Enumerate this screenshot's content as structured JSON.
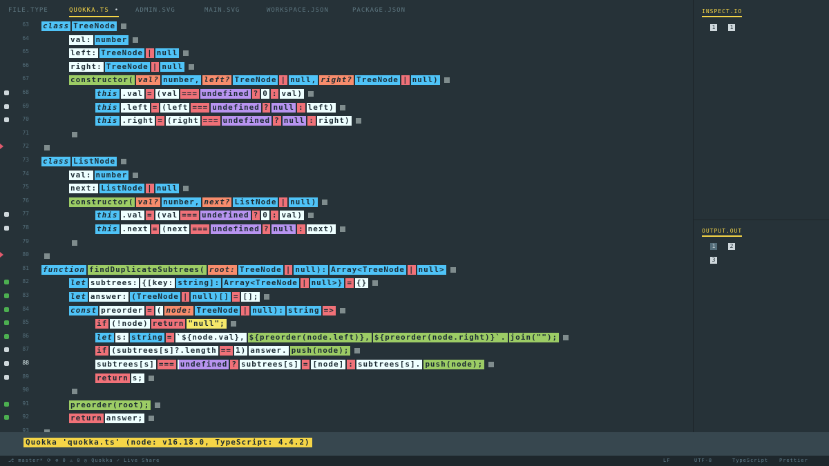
{
  "tabs": [
    {
      "label": "FILE.TYPE",
      "active": false
    },
    {
      "label": "QUOKKA.TS",
      "active": true,
      "modified_dot": "•"
    },
    {
      "label": "ADMIN.SVG",
      "active": false
    },
    {
      "label": "MAIN.SVG",
      "active": false
    },
    {
      "label": "WORKSPACE.JSON",
      "active": false
    },
    {
      "label": "PACKAGE.JSON",
      "active": false
    }
  ],
  "editor": {
    "lines": [
      {
        "n": "63",
        "mark": "",
        "tokens": [
          [
            "kw",
            "class"
          ],
          [
            "ty",
            "TreeNode"
          ]
        ],
        "indent": 0
      },
      {
        "n": "64",
        "mark": "",
        "tokens": [
          [
            "nm",
            "val:"
          ],
          [
            "ty",
            "number"
          ]
        ],
        "indent": 1
      },
      {
        "n": "65",
        "mark": "",
        "tokens": [
          [
            "nm",
            "left:"
          ],
          [
            "ty",
            "TreeNode"
          ],
          [
            "op",
            "|"
          ],
          [
            "ty",
            "null"
          ]
        ],
        "indent": 1
      },
      {
        "n": "66",
        "mark": "",
        "tokens": [
          [
            "nm",
            "right:"
          ],
          [
            "ty",
            "TreeNode"
          ],
          [
            "op",
            "|"
          ],
          [
            "ty",
            "null"
          ]
        ],
        "indent": 1
      },
      {
        "n": "67",
        "mark": "",
        "tokens": [
          [
            "fn",
            "constructor("
          ],
          [
            "pm",
            "val?"
          ],
          [
            "ty",
            "number,"
          ],
          [
            "pm",
            "left?"
          ],
          [
            "ty",
            "TreeNode"
          ],
          [
            "op",
            "|"
          ],
          [
            "ty",
            "null,"
          ],
          [
            "pm",
            "right?"
          ],
          [
            "ty",
            "TreeNode"
          ],
          [
            "op",
            "|"
          ],
          [
            "ty",
            "null)"
          ]
        ],
        "indent": 1
      },
      {
        "n": "68",
        "mark": "gray",
        "tokens": [
          [
            "kw",
            "this"
          ],
          [
            "nm",
            ".val"
          ],
          [
            "op",
            "="
          ],
          [
            "nm",
            "(val"
          ],
          [
            "op",
            "==="
          ],
          [
            "pr",
            "undefined"
          ],
          [
            "op",
            "?"
          ],
          [
            "nm",
            "0"
          ],
          [
            "op",
            ":"
          ],
          [
            "nm",
            "val)"
          ]
        ],
        "indent": 2
      },
      {
        "n": "69",
        "mark": "gray",
        "tokens": [
          [
            "kw",
            "this"
          ],
          [
            "nm",
            ".left"
          ],
          [
            "op",
            "="
          ],
          [
            "nm",
            "(left"
          ],
          [
            "op",
            "==="
          ],
          [
            "pr",
            "undefined"
          ],
          [
            "op",
            "?"
          ],
          [
            "pr",
            "null"
          ],
          [
            "op",
            ":"
          ],
          [
            "nm",
            "left)"
          ]
        ],
        "indent": 2
      },
      {
        "n": "70",
        "mark": "gray",
        "tokens": [
          [
            "kw",
            "this"
          ],
          [
            "nm",
            ".right"
          ],
          [
            "op",
            "="
          ],
          [
            "nm",
            "(right"
          ],
          [
            "op",
            "==="
          ],
          [
            "pr",
            "undefined"
          ],
          [
            "op",
            "?"
          ],
          [
            "pr",
            "null"
          ],
          [
            "op",
            ":"
          ],
          [
            "nm",
            "right)"
          ]
        ],
        "indent": 2
      },
      {
        "n": "71",
        "mark": "",
        "tokens": [],
        "indent": 1,
        "box": true
      },
      {
        "n": "72",
        "mark": "arrow",
        "tokens": [],
        "indent": 0,
        "box": true
      },
      {
        "n": "73",
        "mark": "",
        "tokens": [
          [
            "kw",
            "class"
          ],
          [
            "ty",
            "ListNode"
          ]
        ],
        "indent": 0
      },
      {
        "n": "74",
        "mark": "",
        "tokens": [
          [
            "nm",
            "val:"
          ],
          [
            "ty",
            "number"
          ]
        ],
        "indent": 1
      },
      {
        "n": "75",
        "mark": "",
        "tokens": [
          [
            "nm",
            "next:"
          ],
          [
            "ty",
            "ListNode"
          ],
          [
            "op",
            "|"
          ],
          [
            "ty",
            "null"
          ]
        ],
        "indent": 1
      },
      {
        "n": "76",
        "mark": "",
        "tokens": [
          [
            "fn",
            "constructor("
          ],
          [
            "pm",
            "val?"
          ],
          [
            "ty",
            "number,"
          ],
          [
            "pm",
            "next?"
          ],
          [
            "ty",
            "ListNode"
          ],
          [
            "op",
            "|"
          ],
          [
            "ty",
            "null)"
          ]
        ],
        "indent": 1
      },
      {
        "n": "77",
        "mark": "gray",
        "tokens": [
          [
            "kw",
            "this"
          ],
          [
            "nm",
            ".val"
          ],
          [
            "op",
            "="
          ],
          [
            "nm",
            "(val"
          ],
          [
            "op",
            "==="
          ],
          [
            "pr",
            "undefined"
          ],
          [
            "op",
            "?"
          ],
          [
            "nm",
            "0"
          ],
          [
            "op",
            ":"
          ],
          [
            "nm",
            "val)"
          ]
        ],
        "indent": 2
      },
      {
        "n": "78",
        "mark": "gray",
        "tokens": [
          [
            "kw",
            "this"
          ],
          [
            "nm",
            ".next"
          ],
          [
            "op",
            "="
          ],
          [
            "nm",
            "(next"
          ],
          [
            "op",
            "==="
          ],
          [
            "pr",
            "undefined"
          ],
          [
            "op",
            "?"
          ],
          [
            "pr",
            "null"
          ],
          [
            "op",
            ":"
          ],
          [
            "nm",
            "next)"
          ]
        ],
        "indent": 2
      },
      {
        "n": "79",
        "mark": "",
        "tokens": [],
        "indent": 1,
        "box": true
      },
      {
        "n": "80",
        "mark": "arrow",
        "tokens": [],
        "indent": 0,
        "box": true
      },
      {
        "n": "81",
        "mark": "",
        "tokens": [
          [
            "kw",
            "function"
          ],
          [
            "fn",
            "findDuplicateSubtrees("
          ],
          [
            "pm",
            "root:"
          ],
          [
            "ty",
            "TreeNode"
          ],
          [
            "op",
            "|"
          ],
          [
            "ty",
            "null):"
          ],
          [
            "ty",
            "Array<TreeNode"
          ],
          [
            "op",
            "|"
          ],
          [
            "ty",
            "null>"
          ]
        ],
        "indent": 0
      },
      {
        "n": "82",
        "mark": "green",
        "tokens": [
          [
            "kw",
            "let"
          ],
          [
            "nm",
            "subtrees:"
          ],
          [
            "nm",
            "{[key:"
          ],
          [
            "ty",
            "string]:"
          ],
          [
            "ty",
            "Array<TreeNode"
          ],
          [
            "op",
            "|"
          ],
          [
            "ty",
            "null>}"
          ],
          [
            "op",
            "="
          ],
          [
            "nm",
            "{}"
          ]
        ],
        "indent": 1
      },
      {
        "n": "83",
        "mark": "green",
        "tokens": [
          [
            "kw",
            "let"
          ],
          [
            "nm",
            "answer:"
          ],
          [
            "ty",
            "(TreeNode"
          ],
          [
            "op",
            "|"
          ],
          [
            "ty",
            "null)[]"
          ],
          [
            "op",
            "="
          ],
          [
            "nm",
            "[];"
          ]
        ],
        "indent": 1
      },
      {
        "n": "84",
        "mark": "green",
        "tokens": [
          [
            "kw",
            "const"
          ],
          [
            "nm",
            "preorder"
          ],
          [
            "op",
            "="
          ],
          [
            "nm",
            "("
          ],
          [
            "pm",
            "node:"
          ],
          [
            "ty",
            "TreeNode"
          ],
          [
            "op",
            "|"
          ],
          [
            "ty",
            "null):"
          ],
          [
            "ty",
            "string"
          ],
          [
            "op",
            "=>"
          ]
        ],
        "indent": 1
      },
      {
        "n": "85",
        "mark": "green",
        "tokens": [
          [
            "op",
            "if"
          ],
          [
            "nm",
            "(!node)"
          ],
          [
            "op",
            "return"
          ],
          [
            "st",
            "\"null\";"
          ]
        ],
        "indent": 2
      },
      {
        "n": "86",
        "mark": "green",
        "tokens": [
          [
            "kw",
            "let"
          ],
          [
            "nm",
            "s:"
          ],
          [
            "ty",
            "string"
          ],
          [
            "op",
            "="
          ],
          [
            "nm",
            "`${node.val},"
          ],
          [
            "fn",
            "${preorder(node.left)},"
          ],
          [
            "fn",
            "${preorder(node.right)}`."
          ],
          [
            "fn",
            "join(\"\");"
          ]
        ],
        "indent": 2
      },
      {
        "n": "87",
        "mark": "gray",
        "tokens": [
          [
            "op",
            "if"
          ],
          [
            "nm",
            "(subtrees[s]?.length"
          ],
          [
            "op",
            "=="
          ],
          [
            "nm",
            "1)"
          ],
          [
            "nm",
            "answer."
          ],
          [
            "fn",
            "push(node);"
          ]
        ],
        "indent": 2
      },
      {
        "n": "88",
        "mark": "gray",
        "cur": true,
        "tokens": [
          [
            "nm",
            "subtrees[s]"
          ],
          [
            "op",
            "==="
          ],
          [
            "pr",
            "undefined"
          ],
          [
            "op",
            "?"
          ],
          [
            "nm",
            "subtrees[s]"
          ],
          [
            "op",
            "="
          ],
          [
            "nm",
            "[node]"
          ],
          [
            "op",
            ":"
          ],
          [
            "nm",
            "subtrees[s]."
          ],
          [
            "fn",
            "push(node);"
          ]
        ],
        "indent": 2
      },
      {
        "n": "89",
        "mark": "gray",
        "tokens": [
          [
            "op",
            "return"
          ],
          [
            "nm",
            "s;"
          ]
        ],
        "indent": 2
      },
      {
        "n": "90",
        "mark": "",
        "tokens": [],
        "indent": 1,
        "box": true
      },
      {
        "n": "91",
        "mark": "green",
        "tokens": [
          [
            "fn",
            "preorder(root);"
          ]
        ],
        "indent": 1
      },
      {
        "n": "92",
        "mark": "green",
        "tokens": [
          [
            "op",
            "return"
          ],
          [
            "nm",
            "answer;"
          ]
        ],
        "indent": 1
      },
      {
        "n": "93",
        "mark": "",
        "tokens": [],
        "indent": 0,
        "box": true
      }
    ]
  },
  "right_panel": {
    "top_title": "INSPECT.IO",
    "top_chips": [
      "1",
      "1"
    ],
    "bottom_title": "OUTPUT.OUT",
    "bottom_chips": [
      "1",
      "2",
      "3"
    ]
  },
  "output": {
    "message": "Quokka 'quokka.ts' (node: v16.18.0, TypeScript: 4.4.2)"
  },
  "status": {
    "left": "⎇ master* ⟳ ⊗ 0 ⚠ 0 ◎ Quokka ✓ Live Share",
    "right_items": [
      "LF",
      "UTF-8",
      "TypeScript",
      "Prettier"
    ]
  },
  "colors": {
    "background": "#263238",
    "keyword": "#4fc3f7",
    "operator": "#f07178",
    "function": "#9ccc65",
    "param": "#f78c6c",
    "builtin": "#b894f0",
    "string": "#f5e86a",
    "accent": "#f5d547"
  }
}
